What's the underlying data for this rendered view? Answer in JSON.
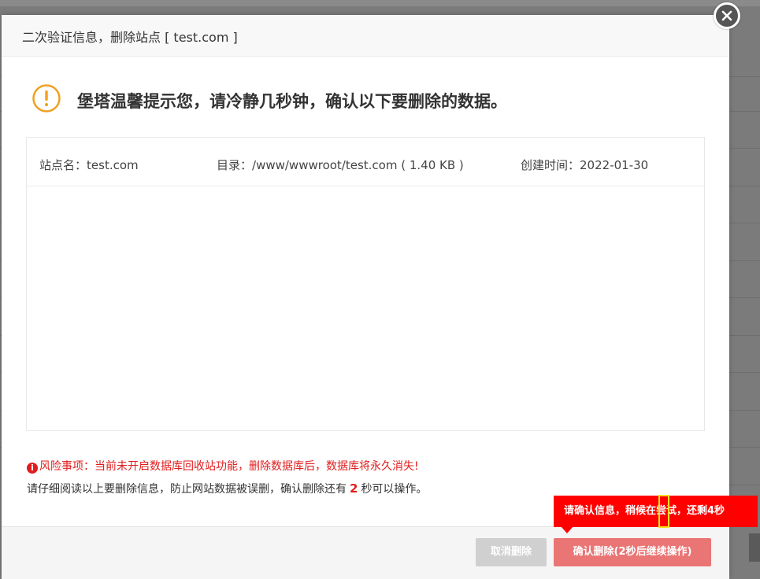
{
  "dialog": {
    "title": "二次验证信息，删除站点 [ test.com ]",
    "warning_heading": "堡塔温馨提示您，请冷静几秒钟，确认以下要删除的数据。",
    "info": {
      "site_label": "站点名：",
      "site_value": "test.com",
      "dir_label": "目录：",
      "dir_value": "/www/wwwroot/test.com ( 1.40 KB )",
      "time_label": "创建时间：",
      "time_value": "2022-01-30"
    },
    "risk_text": "风险事项：当前未开启数据库回收站功能，删除数据库后，数据库将永久消失!",
    "read_text_before": "请仔细阅读以上要删除信息，防止网站数据被误删，确认删除还有",
    "countdown_value": "2",
    "read_text_after": "秒可以操作。",
    "cancel_label": "取消删除",
    "confirm_label": "确认删除(2秒后继续操作)"
  },
  "tooltip": {
    "text": "请确认信息，稍候在尝试，还剩4秒"
  },
  "colors": {
    "warning_orange": "#f0a020",
    "risk_red": "#e01d1d",
    "tooltip_red": "#ff0000",
    "confirm_button": "#ea7575",
    "cancel_button": "#d0d0d0"
  },
  "icons": {
    "close": "close-icon",
    "warning": "warning-icon",
    "risk": "info-icon"
  }
}
